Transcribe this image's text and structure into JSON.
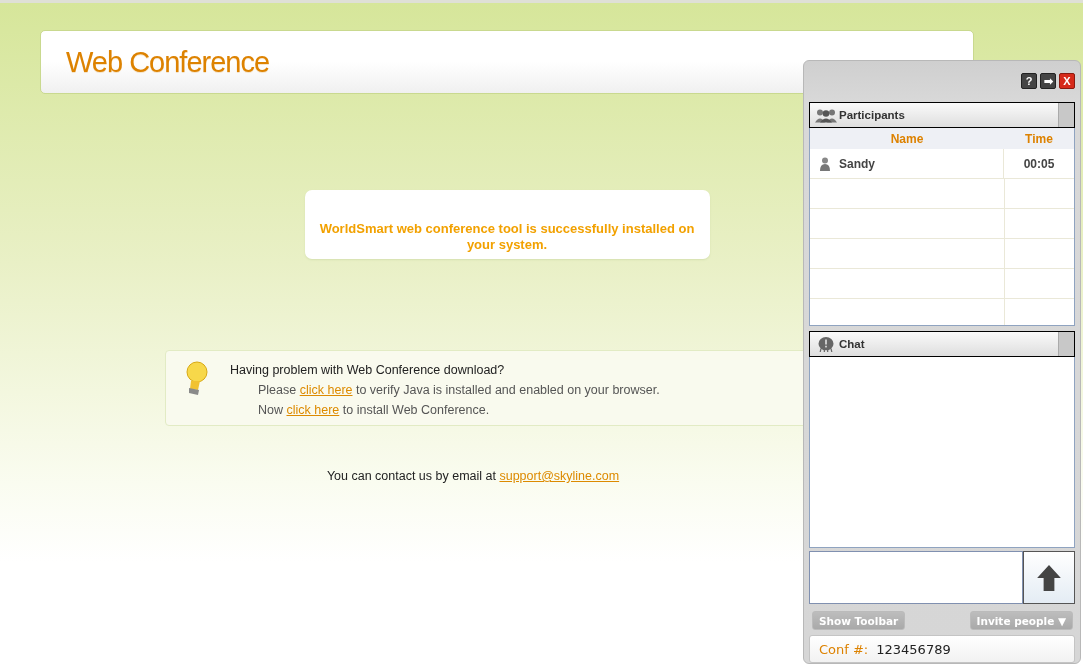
{
  "header": {
    "title": "Web Conference"
  },
  "status_message": "WorldSmart web conference tool is successfully installed on your system.",
  "help": {
    "heading": "Having problem with Web Conference download?",
    "lines": [
      {
        "before": "Please ",
        "link": "click here",
        "after": " to verify Java is installed and enabled on your browser."
      },
      {
        "before": "Now ",
        "link": "click here",
        "after": " to install Web Conference."
      }
    ]
  },
  "contact": {
    "text": "You can contact us by email at ",
    "email": "support@skyline.com"
  },
  "panel": {
    "window_buttons": [
      "?",
      "➡",
      "X"
    ],
    "participants": {
      "title": "Participants",
      "columns": [
        "Name",
        "Time"
      ],
      "rows": [
        {
          "name": "Sandy",
          "time": "00:05"
        }
      ]
    },
    "chat": {
      "title": "Chat"
    },
    "show_toolbar": "Show Toolbar",
    "invite": "Invite people",
    "invite_caret": "▼",
    "conf_label": "Conf #:",
    "conf_number": "123456789"
  }
}
